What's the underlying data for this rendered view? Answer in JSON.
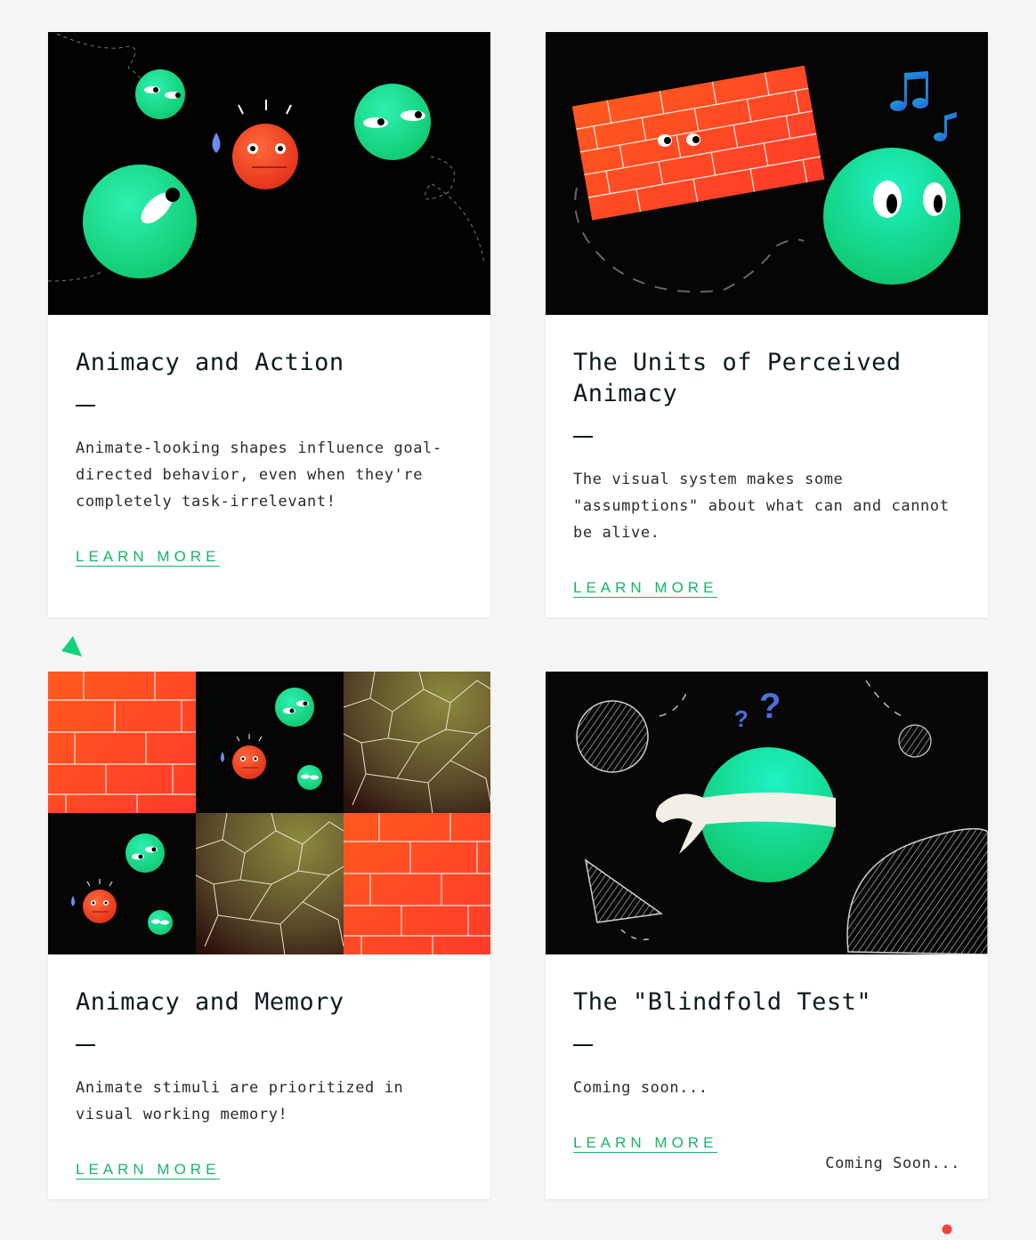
{
  "cards": [
    {
      "title": "Animacy and Action",
      "description": "Animate-looking shapes influence goal-directed behavior, even when they're completely task-irrelevant!",
      "link": "LEARN MORE"
    },
    {
      "title": "The Units of Perceived Animacy",
      "description": "The visual system makes some \"assumptions\" about what can and cannot be alive.",
      "link": "LEARN MORE"
    },
    {
      "title": "Animacy and Memory",
      "description": "Animate stimuli are prioritized in visual working memory!",
      "link": "LEARN MORE"
    },
    {
      "title": "The \"Blindfold Test\"",
      "description": "Coming soon...",
      "link": "LEARN MORE",
      "note": "Coming Soon..."
    }
  ],
  "colors": {
    "accent": "#16b36a",
    "character_green": "#18d98c",
    "character_red": "#f2441c",
    "dark_text": "#0d1b1e"
  }
}
